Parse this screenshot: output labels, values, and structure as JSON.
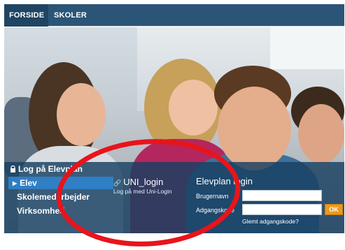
{
  "nav": {
    "items": [
      {
        "label": "FORSIDE",
        "active": true
      },
      {
        "label": "SKOLER",
        "active": false
      }
    ],
    "background": "#2b5577"
  },
  "login_panel": {
    "title": "Log på Elevplan",
    "roles": [
      {
        "label": "Elev",
        "selected": true
      },
      {
        "label": "Skolemedarbejder",
        "selected": false
      },
      {
        "label": "Virksomhed",
        "selected": false
      }
    ],
    "uni_login": {
      "title": "UNI_login",
      "subtitle": "Log på med Uni-Login"
    },
    "elevplan_login": {
      "title": "Elevplan login",
      "username_label": "Brugernavn",
      "username_value": "",
      "password_label": "Adgangskode",
      "password_value": "",
      "ok_label": "OK",
      "forgot_label": "Glemt adgangskode?"
    },
    "accent": "#2f7fc4",
    "button_color": "#ec9a1d"
  },
  "annotation": {
    "shape": "ellipse",
    "color": "#e8141b"
  }
}
